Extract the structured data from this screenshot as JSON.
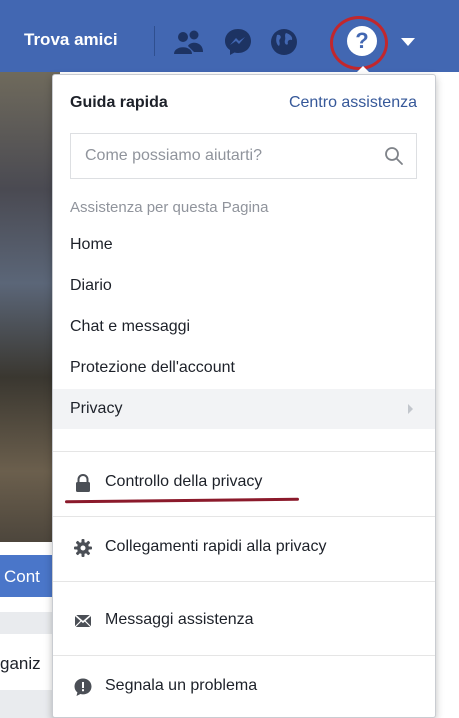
{
  "topbar": {
    "find_friends": "Trova amici",
    "icons": [
      "friends-icon",
      "messenger-icon",
      "globe-icon",
      "help-icon",
      "caret-down-icon"
    ],
    "help_glyph": "?",
    "accent": "#4267b2",
    "highlight_ring": "#c1272d"
  },
  "background": {
    "button_fragment": "Cont",
    "text_fragment": "ganiz"
  },
  "dropdown": {
    "title": "Guida rapida",
    "help_center": "Centro assistenza",
    "search": {
      "placeholder": "Come possiamo aiutarti?",
      "value": ""
    },
    "section_label": "Assistenza per questa Pagina",
    "items": [
      {
        "label": "Home"
      },
      {
        "label": "Diario"
      },
      {
        "label": "Chat e messaggi"
      },
      {
        "label": "Protezione dell'account"
      },
      {
        "label": "Privacy",
        "has_submenu": true
      }
    ],
    "actions": [
      {
        "label": "Controllo della privacy",
        "icon": "lock-icon"
      },
      {
        "label": "Collegamenti rapidi alla privacy",
        "icon": "gear-icon"
      },
      {
        "label": "Messaggi assistenza",
        "icon": "envelope-icon"
      },
      {
        "label": "Segnala un problema",
        "icon": "alert-icon"
      }
    ]
  }
}
